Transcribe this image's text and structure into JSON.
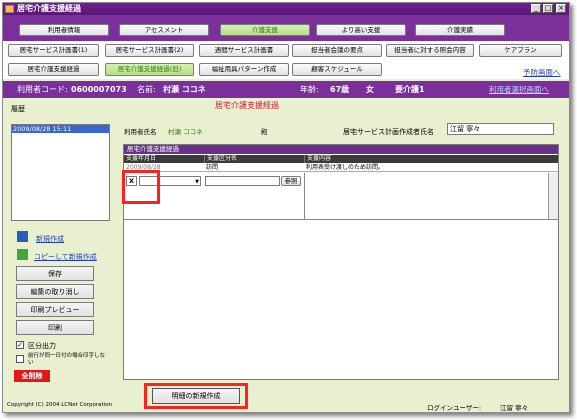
{
  "window": {
    "title": "居宅介護支援経過",
    "min": "_",
    "max": "□",
    "close": "×"
  },
  "menu_row1": [
    "利用者情報",
    "アセスメント",
    "介護支援",
    "より高い支援",
    "介護実績"
  ],
  "menu_row2": [
    "居宅サービス計画書(1)",
    "居宅サービス計画書(2)",
    "週間サービス計画書",
    "担当者会議の要点",
    "担当者に対する照会内容",
    "ケアプラン"
  ],
  "menu_row3": [
    "居宅介護支援経過",
    "居宅介護支援経過(旧)",
    "福祉用具パターン作成",
    "顧客スケジュール"
  ],
  "links": {
    "prevention": "予防画面へ",
    "user_select": "利用者選択画面へ"
  },
  "info": {
    "code_label": "利用者コード:",
    "code": "0600007073",
    "name_label": "名前:",
    "name": "村瀬 ココネ",
    "age_label": "年齢:",
    "age": "67歳",
    "sex": "女",
    "care": "要介護1"
  },
  "page_title": "居宅介護支援経過",
  "history": {
    "label": "履歴",
    "items": [
      "2009/08/28 15:11"
    ]
  },
  "form": {
    "user_label": "利用者氏名",
    "user_name": "村瀬 ココネ",
    "honorific": "殿",
    "creator_label": "居宅サービス計画作成者氏名",
    "creator_name": "江留 寧々"
  },
  "panel": {
    "title": "居宅介護支援経過",
    "col_date": "支援年月日",
    "col_type": "支援区分名",
    "col_content": "支援内容",
    "row_date": "2009/08/28",
    "row_type": "訪問",
    "row_content": "利用表受け渡しのため訪問。",
    "ref_button": "参照",
    "delete_mark": "X"
  },
  "left_actions": {
    "new": "新規作成",
    "copy_new": "コピーして新規作成",
    "save": "保存",
    "cancel_edit": "編集の取り消し",
    "print_preview": "印刷プレビュー",
    "print": "印刷",
    "section_output": "区分出力",
    "same_day_label": "前行が同一日付の場合印字しない",
    "delete_all": "全削除"
  },
  "bottom": {
    "new_detail": "明細の新規作成",
    "copyright": "Copyright (C) 2004 LCNet Corporation",
    "login_label": "ログインユーザー:",
    "login_user": "江留 寧々"
  }
}
